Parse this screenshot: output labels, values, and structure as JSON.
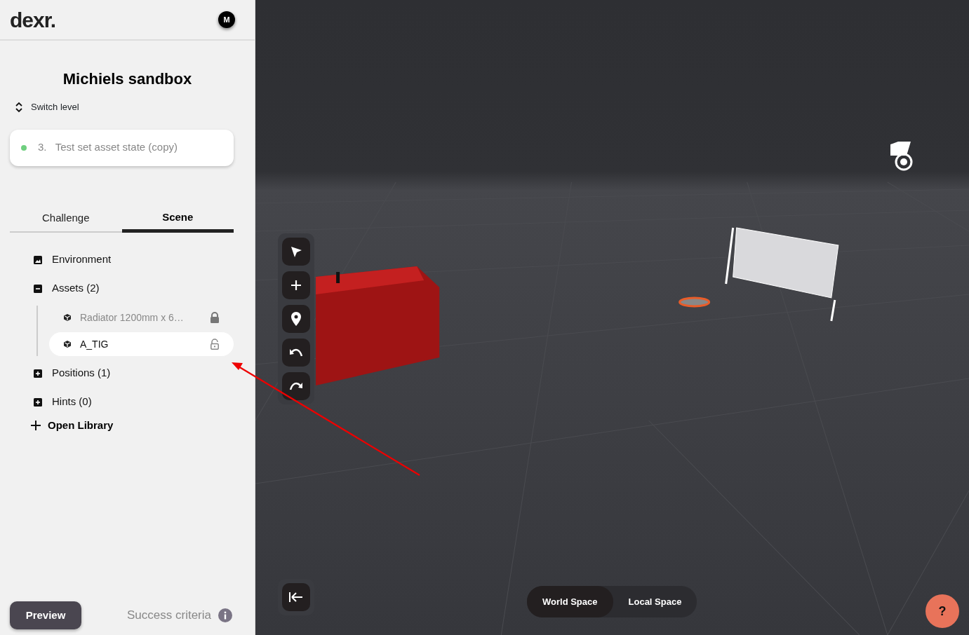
{
  "app": {
    "logo": "dexr.",
    "avatar": "M"
  },
  "project": {
    "title": "Michiels sandbox",
    "switch_label": "Switch level"
  },
  "level": {
    "number": "3.",
    "name": "Test set asset state (copy)"
  },
  "tabs": [
    {
      "label": "Challenge",
      "selected": false
    },
    {
      "label": "Scene",
      "selected": true
    }
  ],
  "tree": [
    {
      "label": "Environment",
      "kind": "leaf"
    },
    {
      "label": "Assets (2)",
      "kind": "group",
      "expanded": true,
      "children": [
        {
          "label": "Radiator 1200mm x 6…",
          "locked": true,
          "selected": false
        },
        {
          "label": "A_TIG",
          "locked": false,
          "selected": true
        }
      ]
    },
    {
      "label": "Positions (1)",
      "kind": "group",
      "expanded": false
    },
    {
      "label": "Hints (0)",
      "kind": "group",
      "expanded": false
    }
  ],
  "open_library": "Open Library",
  "footer": {
    "preview": "Preview",
    "success_criteria": "Success criteria"
  },
  "space_toggle": [
    {
      "label": "World Space",
      "selected": true
    },
    {
      "label": "Local Space",
      "selected": false
    }
  ],
  "help": "?"
}
